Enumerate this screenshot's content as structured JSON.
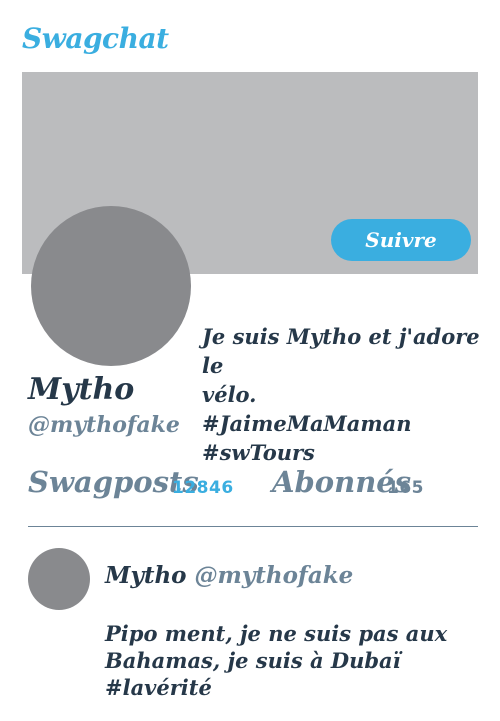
{
  "app": {
    "name": "Swagchat"
  },
  "profile": {
    "follow_label": "Suivre",
    "display_name": "Mytho",
    "handle": "@mythofake",
    "bio_lines": [
      "Je suis Mytho et j'adore le",
      "vélo.",
      "#JaimeMaMaman",
      "#swTours"
    ]
  },
  "stats": {
    "posts_label": "Swagposts",
    "posts_count": "12846",
    "followers_label": "Abonnés",
    "followers_count": "165"
  },
  "post": {
    "author_name": "Mytho",
    "author_handle": "@mythofake",
    "text_lines": [
      "Pipo ment, je ne suis pas aux",
      "Bahamas, je suis à Dubaï #lavérité"
    ]
  },
  "colors": {
    "accent": "#3aaee0",
    "banner": "#bbbcbe",
    "avatar": "#898a8d",
    "text_dark": "#263849",
    "text_muted": "#6c8497"
  }
}
